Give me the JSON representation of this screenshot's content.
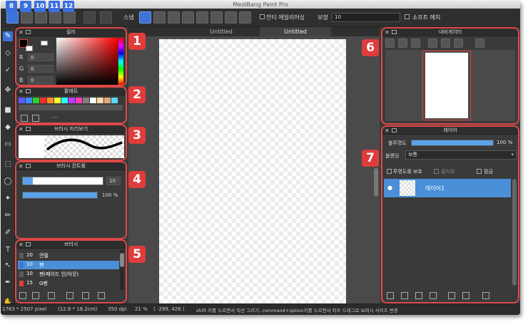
{
  "app": {
    "title": "MediBang Paint Pro"
  },
  "toolbar": {
    "snap_label": "스냅",
    "antialias_label": "안티 에일리어싱",
    "correction_label": "보정",
    "correction_value": "10",
    "soft_edge_label": "소프트 에지"
  },
  "badges": {
    "top": [
      "8",
      "9",
      "10",
      "11",
      "12"
    ],
    "panels": [
      "1",
      "2",
      "3",
      "4",
      "5",
      "6",
      "7"
    ]
  },
  "color_panel": {
    "title": "컬러",
    "channels": [
      {
        "label": "R",
        "value": "0"
      },
      {
        "label": "G",
        "value": "0"
      },
      {
        "label": "B",
        "value": "0"
      }
    ]
  },
  "palette_panel": {
    "title": "팔레트",
    "swatches": [
      "#5b5bff",
      "#3b8fff",
      "#2bd02b",
      "#ff2b2b",
      "#ff8f2b",
      "#ffff2b",
      "#2bffff",
      "#bb3bff",
      "#ff3bbb",
      "#7f7f7f",
      "#ffffff",
      "#ffd7a8",
      "#e0a878",
      "#5ad8ff"
    ],
    "footer_text": "---"
  },
  "brush_preview_panel": {
    "title": "브러시 미리보기"
  },
  "brush_control_panel": {
    "title": "브러시 컨트롤",
    "size_value": "10",
    "opacity_value": "100 %",
    "opacity_fraction": 1.0
  },
  "brush_panel": {
    "title": "브러시",
    "items": [
      {
        "size": "20",
        "name": "연필",
        "color": "#5a5a5a",
        "selected": false
      },
      {
        "size": "10",
        "name": "펜",
        "color": "#3d73d8",
        "selected": true
      },
      {
        "size": "10",
        "name": "펜(페이드 인/아웃)",
        "color": "#5a5a5a",
        "selected": false
      },
      {
        "size": "15",
        "name": "G펜",
        "color": "#e03c3c",
        "selected": false
      }
    ]
  },
  "document": {
    "tabs": [
      "Untitled",
      "Untitled"
    ],
    "active_tab": 1
  },
  "navigator_panel": {
    "title": "내비게이터"
  },
  "layer_panel": {
    "title": "레이어",
    "opacity_label": "불투명도",
    "opacity_value": "100 %",
    "opacity_fraction": 1.0,
    "blend_label": "블렌딩",
    "blend_value": "보통",
    "protect_alpha_label": "투명도를 보호",
    "clipping_label": "클리핑",
    "lock_label": "잠금",
    "layers": [
      {
        "name": "레이어1"
      }
    ]
  },
  "status": {
    "canvas_size": "1763 * 2507 pixel",
    "physical_size": "(12.8 * 18.2cm)",
    "dpi": "350 dpi",
    "zoom": "21 %",
    "coords": "( -299, 426 )",
    "hint": "shift 키를 누르면서 직선 그리기, command+option키를 누르면서 좌우 드래그로 브러시 사이즈 변경"
  }
}
